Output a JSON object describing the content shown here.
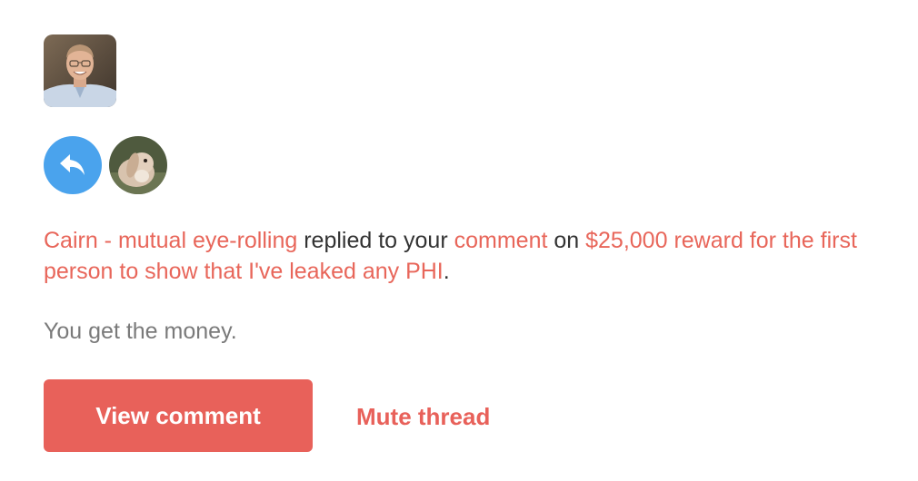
{
  "sender": {
    "avatar_icon": "person-photo-avatar"
  },
  "activity": {
    "icon": "reply-arrow-icon",
    "icon_color": "#4aa3ed",
    "replier_avatar_icon": "rabbit-photo-avatar"
  },
  "notice": {
    "actor": "Cairn - mutual eye-rolling",
    "text_replied": " replied to your ",
    "target": "comment",
    "text_on": " on ",
    "post_title": "$25,000 reward for the first person to show that I've leaked any PHI",
    "period": "."
  },
  "message": {
    "body": "You get the money."
  },
  "actions": {
    "view_label": "View comment",
    "mute_label": "Mute thread"
  },
  "colors": {
    "accent": "#e8615a",
    "link": "#e8665a",
    "reply_blue": "#4aa3ed",
    "muted_text": "#7a7a7a"
  }
}
